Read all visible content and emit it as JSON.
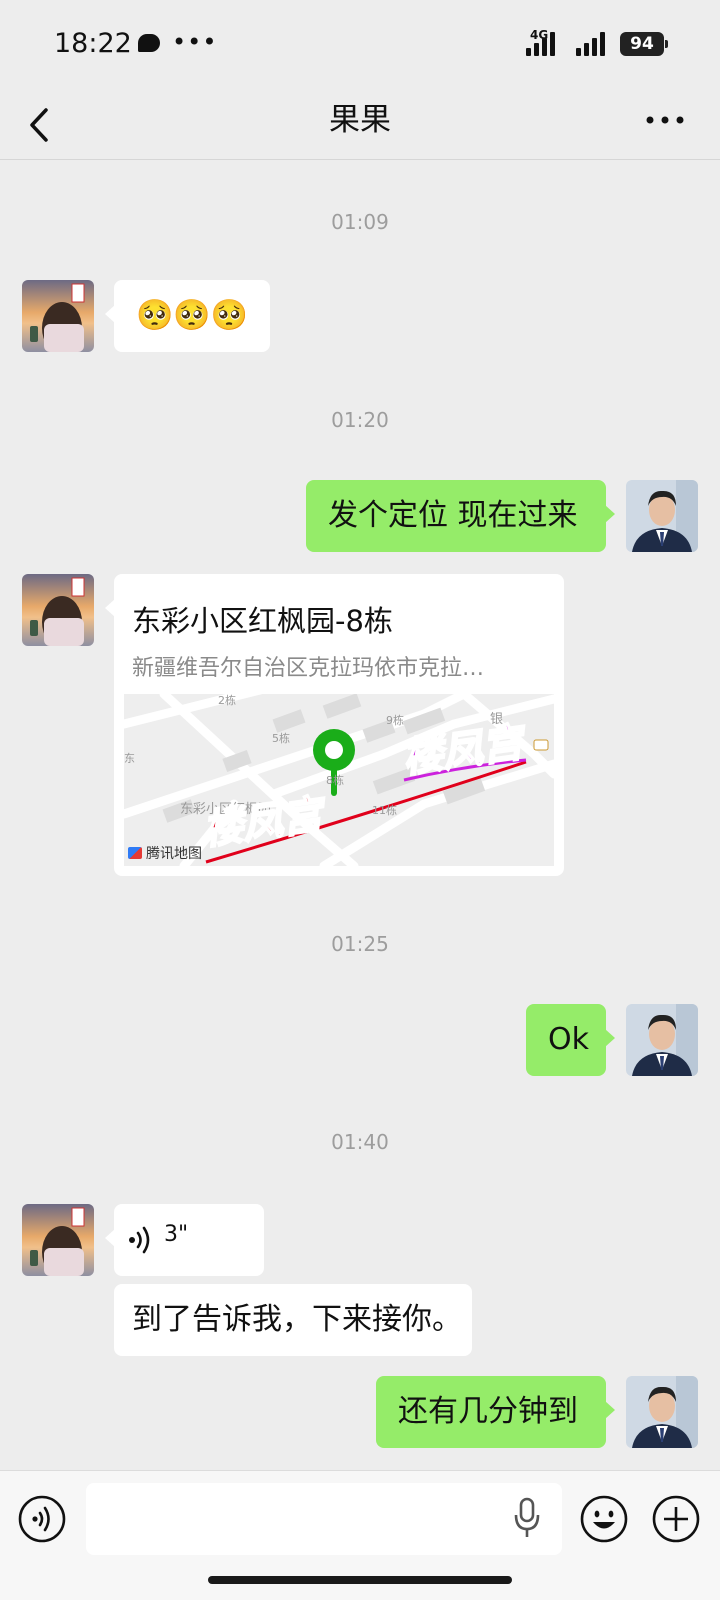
{
  "status_bar": {
    "time": "18:22",
    "network": "4G",
    "battery": "94"
  },
  "header": {
    "title": "果果",
    "back_icon": "chevron-left-icon",
    "more_icon": "more-horizontal-icon"
  },
  "messages": {
    "ts1": "01:09",
    "m1_text": "🥺🥺🥺",
    "ts2": "01:20",
    "m2_text": "发个定位 现在过来",
    "location": {
      "name": "东彩小区红枫园-8栋",
      "address": "新疆维吾尔自治区克拉玛依市克拉…",
      "map_labels": {
        "a": "2栋",
        "b": "5栋",
        "c": "9栋",
        "d": "8栋",
        "e": "11栋",
        "f": "东彩小区红枫园",
        "g": "银",
        "h": "东"
      },
      "watermark": "楼凤宫",
      "credit": "腾讯地图"
    },
    "ts3": "01:25",
    "m4_text": "Ok",
    "ts4": "01:40",
    "voice_duration": "3\"",
    "m6_text": "到了告诉我，下来接你。",
    "m7_text": "还有几分钟到"
  },
  "input_bar": {
    "voice_icon": "voice-mode-icon",
    "mic_icon": "microphone-icon",
    "emoji_icon": "emoji-icon",
    "plus_icon": "plus-circle-icon"
  },
  "colors": {
    "background": "#ededed",
    "my_bubble": "#95ec69",
    "their_bubble": "#ffffff",
    "pin": "#1aad19",
    "watermark_red": "#e0001b",
    "watermark_magenta": "#cc22dd"
  }
}
